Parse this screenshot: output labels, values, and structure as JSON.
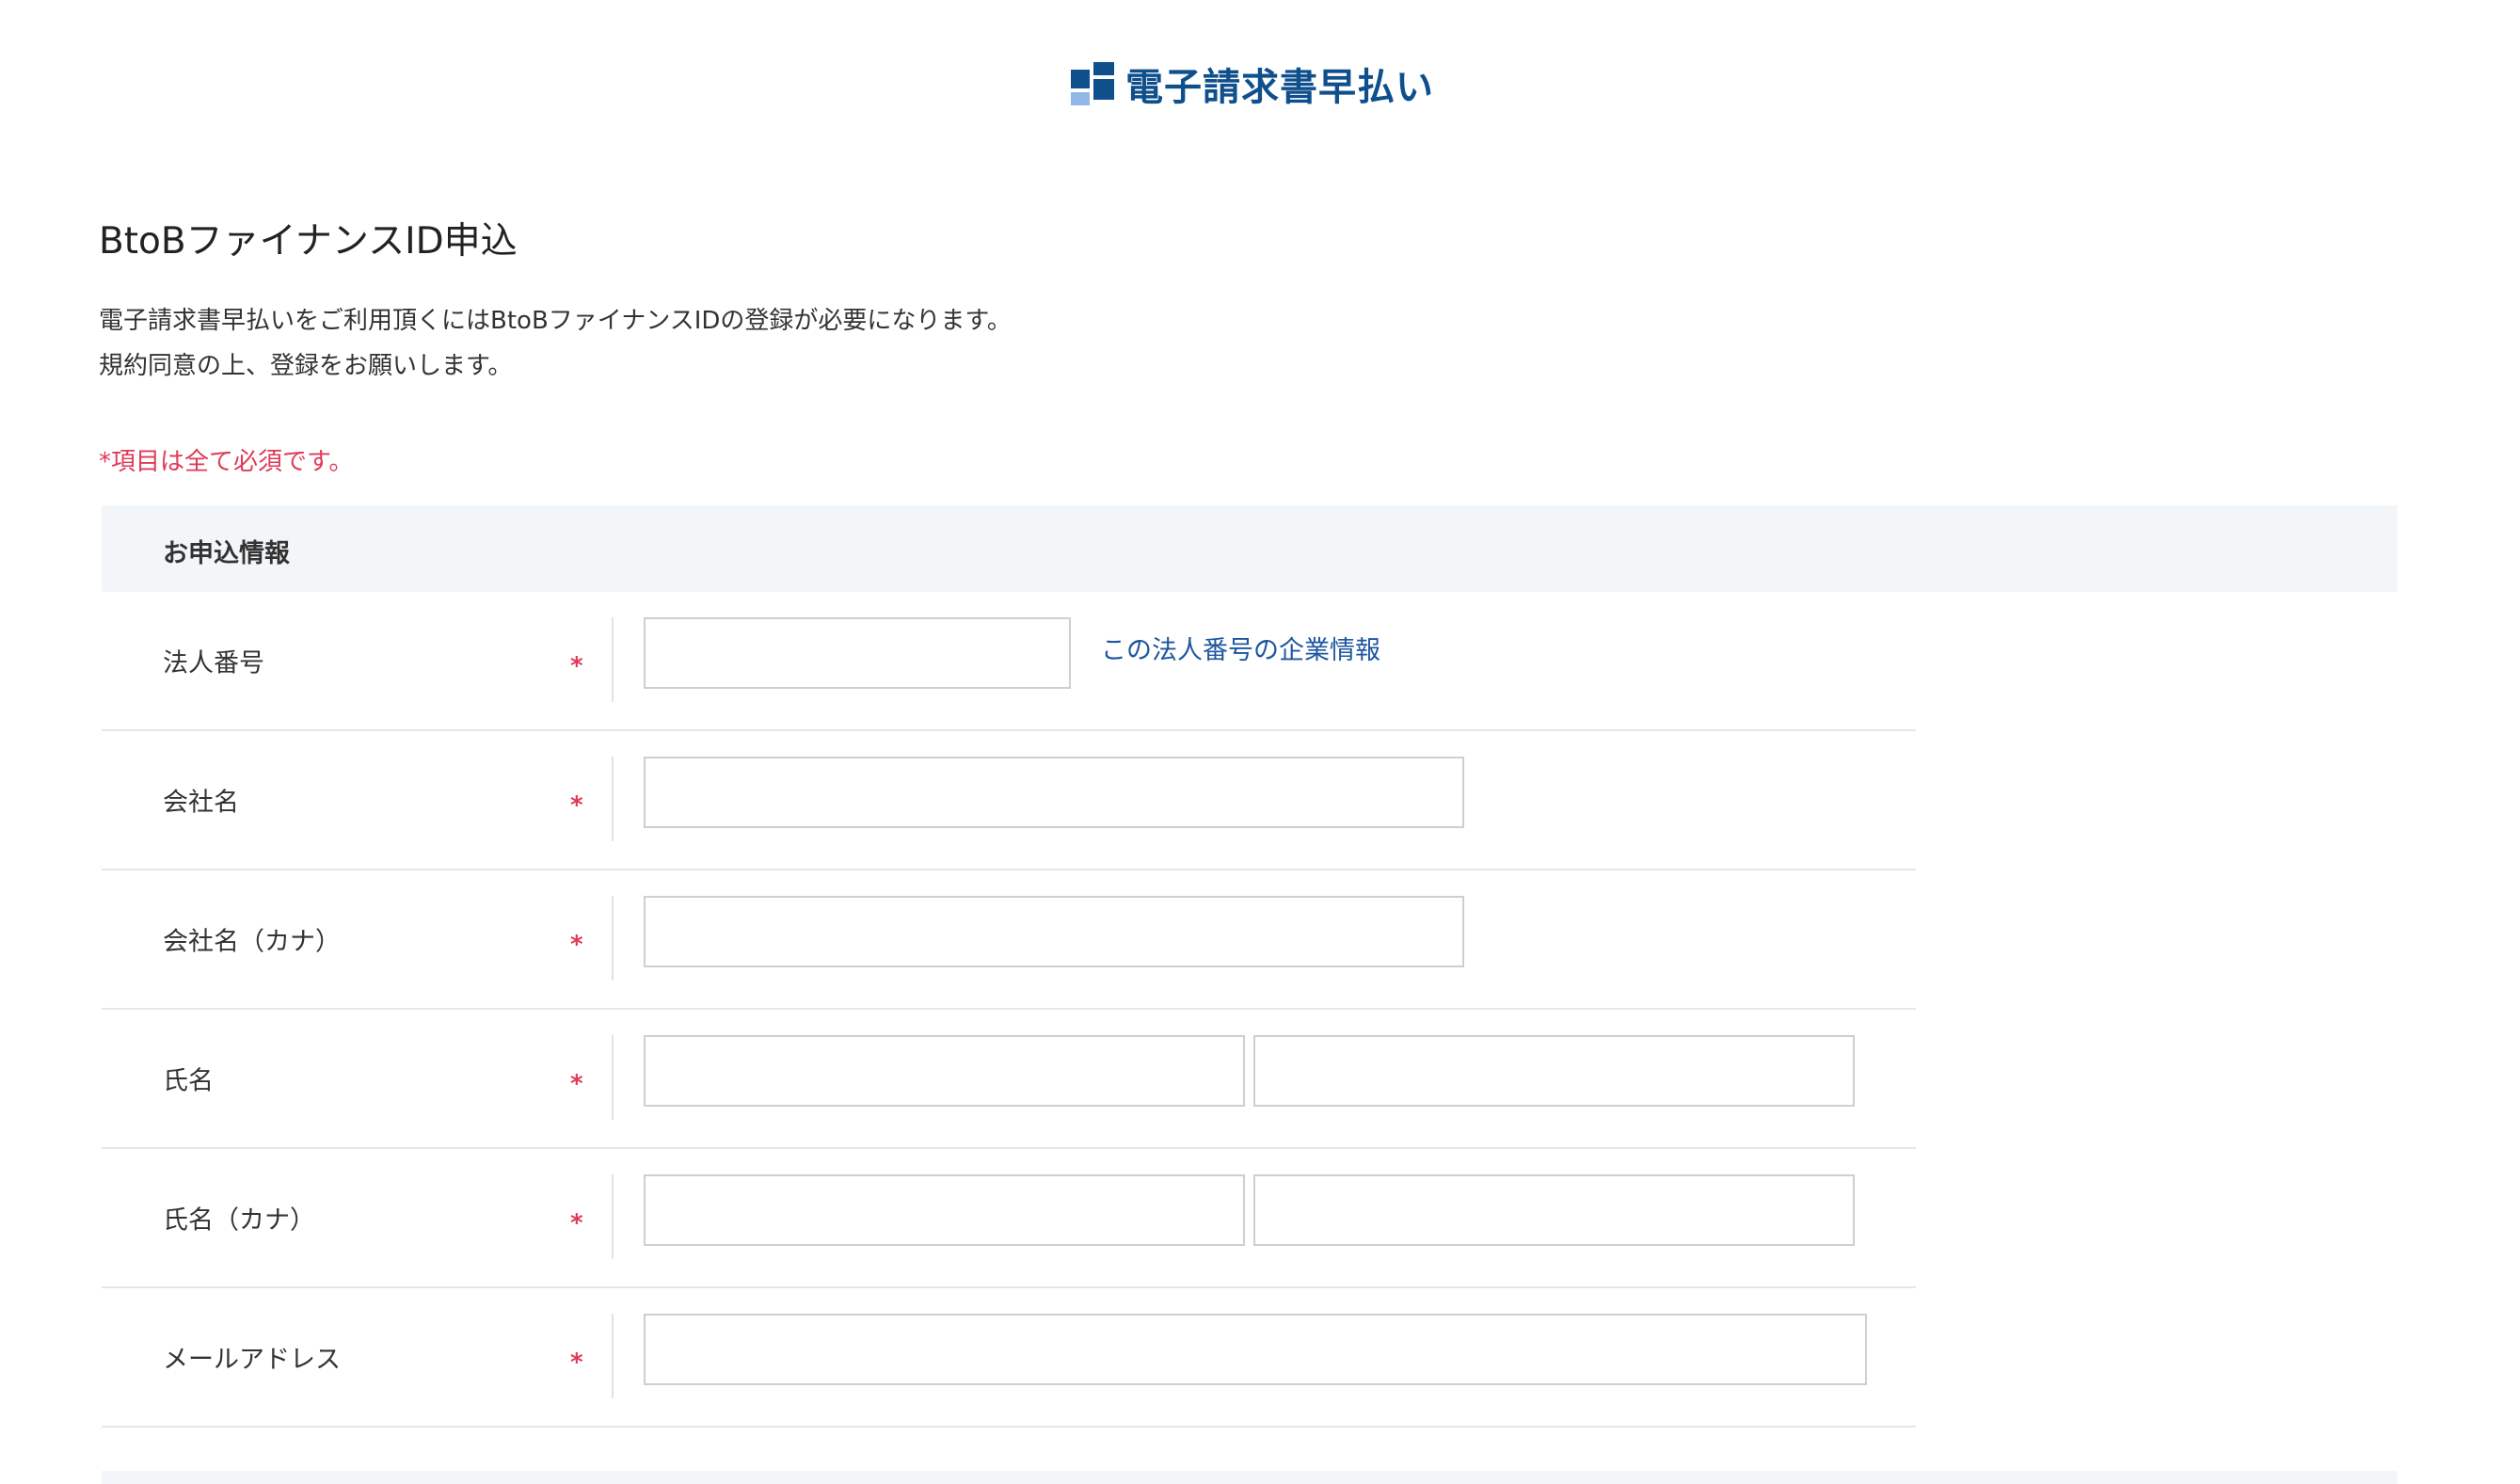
{
  "brand": {
    "name": "電子請求書早払い",
    "colors": {
      "primary": "#0e4f8c",
      "secondary": "#8fb8e6"
    }
  },
  "page": {
    "title": "BtoBファイナンスID申込",
    "intro_line1": "電子請求書早払いをご利用頂くにはBtoBファイナンスIDの登録が必要になります。",
    "intro_line2": "規約同意の上、登録をお願いします。",
    "required_note": "*項目は全て必須です。"
  },
  "section": {
    "title": "お申込情報"
  },
  "required_mark": "*",
  "form": {
    "corporate_number": {
      "label": "法人番号",
      "value": "",
      "link": "この法人番号の企業情報"
    },
    "company_name": {
      "label": "会社名",
      "value": ""
    },
    "company_name_kana": {
      "label": "会社名（カナ）",
      "value": ""
    },
    "full_name": {
      "label": "氏名",
      "last_value": "",
      "first_value": ""
    },
    "full_name_kana": {
      "label": "氏名（カナ）",
      "last_value": "",
      "first_value": ""
    },
    "email": {
      "label": "メールアドレス",
      "value": ""
    }
  },
  "colors": {
    "required": "#e03a57",
    "link": "#1e56a0",
    "section_bg": "#f3f6f9"
  }
}
